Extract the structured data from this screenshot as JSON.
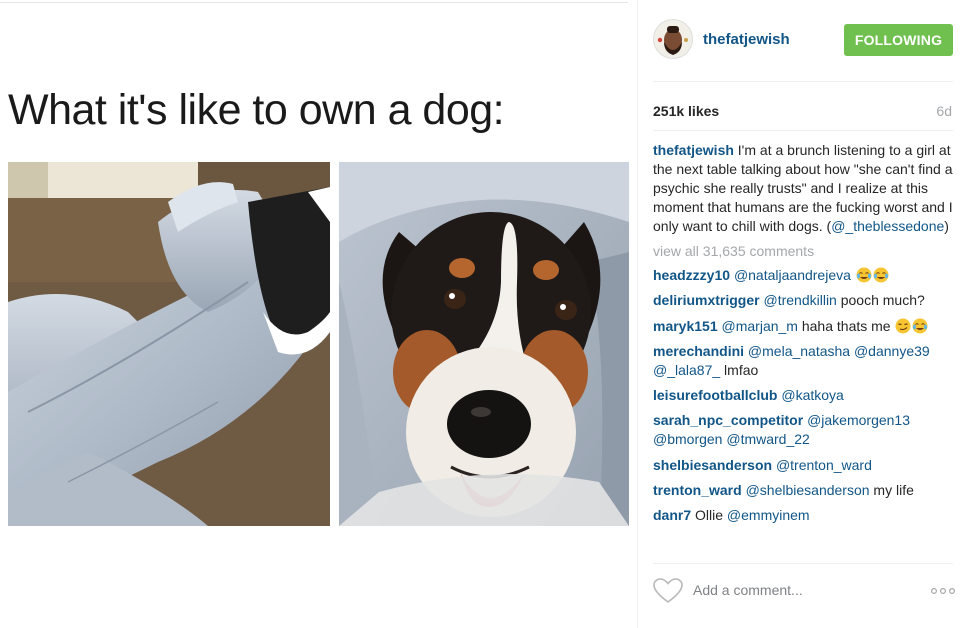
{
  "post": {
    "image": {
      "meme_title": "What it's like to own a dog:",
      "left_photo_icon": "legs-in-jeans-photo",
      "right_photo_icon": "dog-face-photo"
    },
    "author": {
      "username": "thefatjewish",
      "avatar_icon": "user-avatar-icon"
    },
    "follow_label": "FOLLOWING",
    "likes": "251k likes",
    "time_ago": "6d",
    "caption": {
      "user": "thefatjewish",
      "text": " I'm at a brunch listening to a girl at the next table talking about how \"she can't find a psychic she really trusts\" and I realize at this moment that humans are the fucking worst and I only want to chill with dogs. (",
      "mention": "@_theblessedone",
      "text_end": ")"
    },
    "view_all": "view all 31,635 comments",
    "comments": [
      {
        "user": "headzzzy10",
        "mention": "@nataljaandrejeva",
        "text": "",
        "emoji": [
          "joy",
          "joy"
        ]
      },
      {
        "user": "deliriumxtrigger",
        "mention": "@trendkillin",
        "text": " pooch much?",
        "emoji": []
      },
      {
        "user": "maryk151",
        "mention": "@marjan_m",
        "text": " haha thats me",
        "emoji": [
          "smirk",
          "joy"
        ]
      },
      {
        "user": "merechandini",
        "mention": "@mela_natasha @dannye39 @_lala87_",
        "text": " lmfao",
        "emoji": []
      },
      {
        "user": "leisurefootballclub",
        "mention": "@katkoya",
        "text": "",
        "emoji": []
      },
      {
        "user": "sarah_npc_competitor",
        "mention": "@jakemorgen13 @bmorgen @tmward_22",
        "text": "",
        "emoji": []
      },
      {
        "user": "shelbiesanderson",
        "mention": "@trenton_ward",
        "text": "",
        "emoji": []
      },
      {
        "user": "trenton_ward",
        "mention": "@shelbiesanderson",
        "text": " my life",
        "emoji": []
      },
      {
        "user": "danr7",
        "mention": "@emmyinem",
        "text": " Ollie ",
        "emoji": [],
        "text_first": true
      }
    ],
    "add_comment_placeholder": "Add a comment...",
    "icons": {
      "heart": "heart-icon",
      "more": "more-options-icon"
    },
    "colors": {
      "link": "#125688",
      "follow_green": "#70c050",
      "muted": "#a5a7aa"
    }
  }
}
